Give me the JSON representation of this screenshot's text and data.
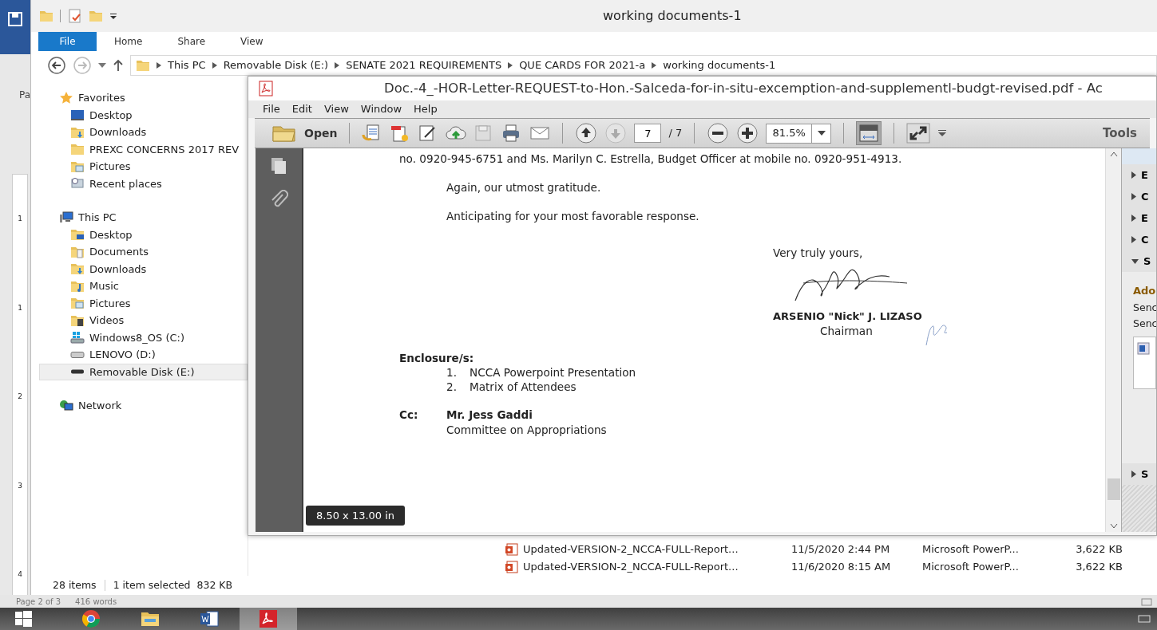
{
  "word_window": {
    "ribbon_label": "Pa",
    "ruler_numbers": [
      "1",
      "1",
      "2",
      "3",
      "4"
    ],
    "status": {
      "page": "Page 2 of 3",
      "words": "416 words"
    }
  },
  "explorer": {
    "title": "working documents-1",
    "ribbon_tabs": [
      {
        "label": "File",
        "selected": true
      },
      {
        "label": "Home",
        "selected": false
      },
      {
        "label": "Share",
        "selected": false
      },
      {
        "label": "View",
        "selected": false
      }
    ],
    "breadcrumb": [
      "This PC",
      "Removable Disk (E:)",
      "SENATE 2021 REQUIREMENTS",
      "QUE CARDS FOR 2021-a",
      "working documents-1"
    ],
    "nav_groups": [
      {
        "label": "Favorites",
        "kind": "favorites",
        "children": [
          {
            "label": "Desktop",
            "kind": "desktop",
            "selected": false
          },
          {
            "label": "Downloads",
            "kind": "downloads",
            "selected": false
          },
          {
            "label": "PREXC CONCERNS 2017 REV",
            "kind": "folder",
            "selected": false
          },
          {
            "label": "Pictures",
            "kind": "pictures",
            "selected": false
          },
          {
            "label": "Recent places",
            "kind": "recent",
            "selected": false
          }
        ]
      },
      {
        "label": "This PC",
        "kind": "computer",
        "children": [
          {
            "label": "Desktop",
            "kind": "desktop-folder",
            "selected": false
          },
          {
            "label": "Documents",
            "kind": "documents",
            "selected": false
          },
          {
            "label": "Downloads",
            "kind": "downloads",
            "selected": false
          },
          {
            "label": "Music",
            "kind": "music",
            "selected": false
          },
          {
            "label": "Pictures",
            "kind": "pictures",
            "selected": false
          },
          {
            "label": "Videos",
            "kind": "videos",
            "selected": false
          },
          {
            "label": "Windows8_OS (C:)",
            "kind": "system-drive",
            "selected": false
          },
          {
            "label": "LENOVO (D:)",
            "kind": "drive",
            "selected": false
          },
          {
            "label": "Removable Disk (E:)",
            "kind": "removable",
            "selected": true
          }
        ]
      },
      {
        "label": "Network",
        "kind": "network"
      }
    ],
    "files": [
      {
        "name": "Updated-VERSION-2_NCCA-FULL-Report...",
        "modified": "11/5/2020 2:44 PM",
        "type": "Microsoft PowerP...",
        "size": "3,622 KB"
      },
      {
        "name": "Updated-VERSION-2_NCCA-FULL-Report...",
        "modified": "11/6/2020 8:15 AM",
        "type": "Microsoft PowerP...",
        "size": "3,622 KB"
      }
    ],
    "status": {
      "items": "28 items",
      "selection": "1 item selected  832 KB"
    }
  },
  "acrobat": {
    "title": "Doc.-4_-HOR-Letter-REQUEST-to-Hon.-Salceda-for-in-situ-excemption-and-supplementl-budgt-revised.pdf - Ac",
    "menu": [
      "File",
      "Edit",
      "View",
      "Window",
      "Help"
    ],
    "toolbar": {
      "open_label": "Open",
      "page": "7",
      "page_count": "/ 7",
      "zoom": "81.5%",
      "fit_page_active": true,
      "tools_label": "Tools"
    },
    "letter": {
      "contact_line": "no. 0920-945-6751 and Ms. Marilyn C. Estrella, Budget Officer at mobile no. 0920-951-4913.",
      "paragraphs": [
        "Again, our utmost gratitude.",
        "Anticipating for your most favorable response."
      ],
      "closing": "Very truly yours,",
      "signatory": "ARSENIO \"Nick\" J. LIZASO",
      "signatory_title": "Chairman",
      "enclosure_heading": "Enclosure/s:",
      "enclosures": [
        {
          "number": "1.",
          "text": "NCCA Powerpoint Presentation"
        },
        {
          "number": "2.",
          "text": "Matrix of Attendees"
        }
      ],
      "cc_label": "Cc:",
      "cc_name": "Mr. Jess Gaddi",
      "cc_office": "Committee on Appropriations"
    },
    "page_size_tooltip": "8.50 x 13.00 in",
    "tools_panel": {
      "sections": [
        {
          "label": "E",
          "expanded": false
        },
        {
          "label": "C",
          "expanded": false
        },
        {
          "label": "E",
          "expanded": false
        },
        {
          "label": "C",
          "expanded": false
        },
        {
          "label": "S",
          "expanded": true,
          "heading": "Ado",
          "lines": [
            "Senc",
            "Senc"
          ]
        },
        {
          "label": "S",
          "expanded": false
        }
      ]
    }
  },
  "taskbar": {
    "apps": [
      {
        "kind": "start",
        "selected": false
      },
      {
        "kind": "browser",
        "selected": false
      },
      {
        "kind": "files",
        "selected": false
      },
      {
        "kind": "word",
        "selected": false
      },
      {
        "kind": "pdf",
        "selected": true
      }
    ]
  }
}
